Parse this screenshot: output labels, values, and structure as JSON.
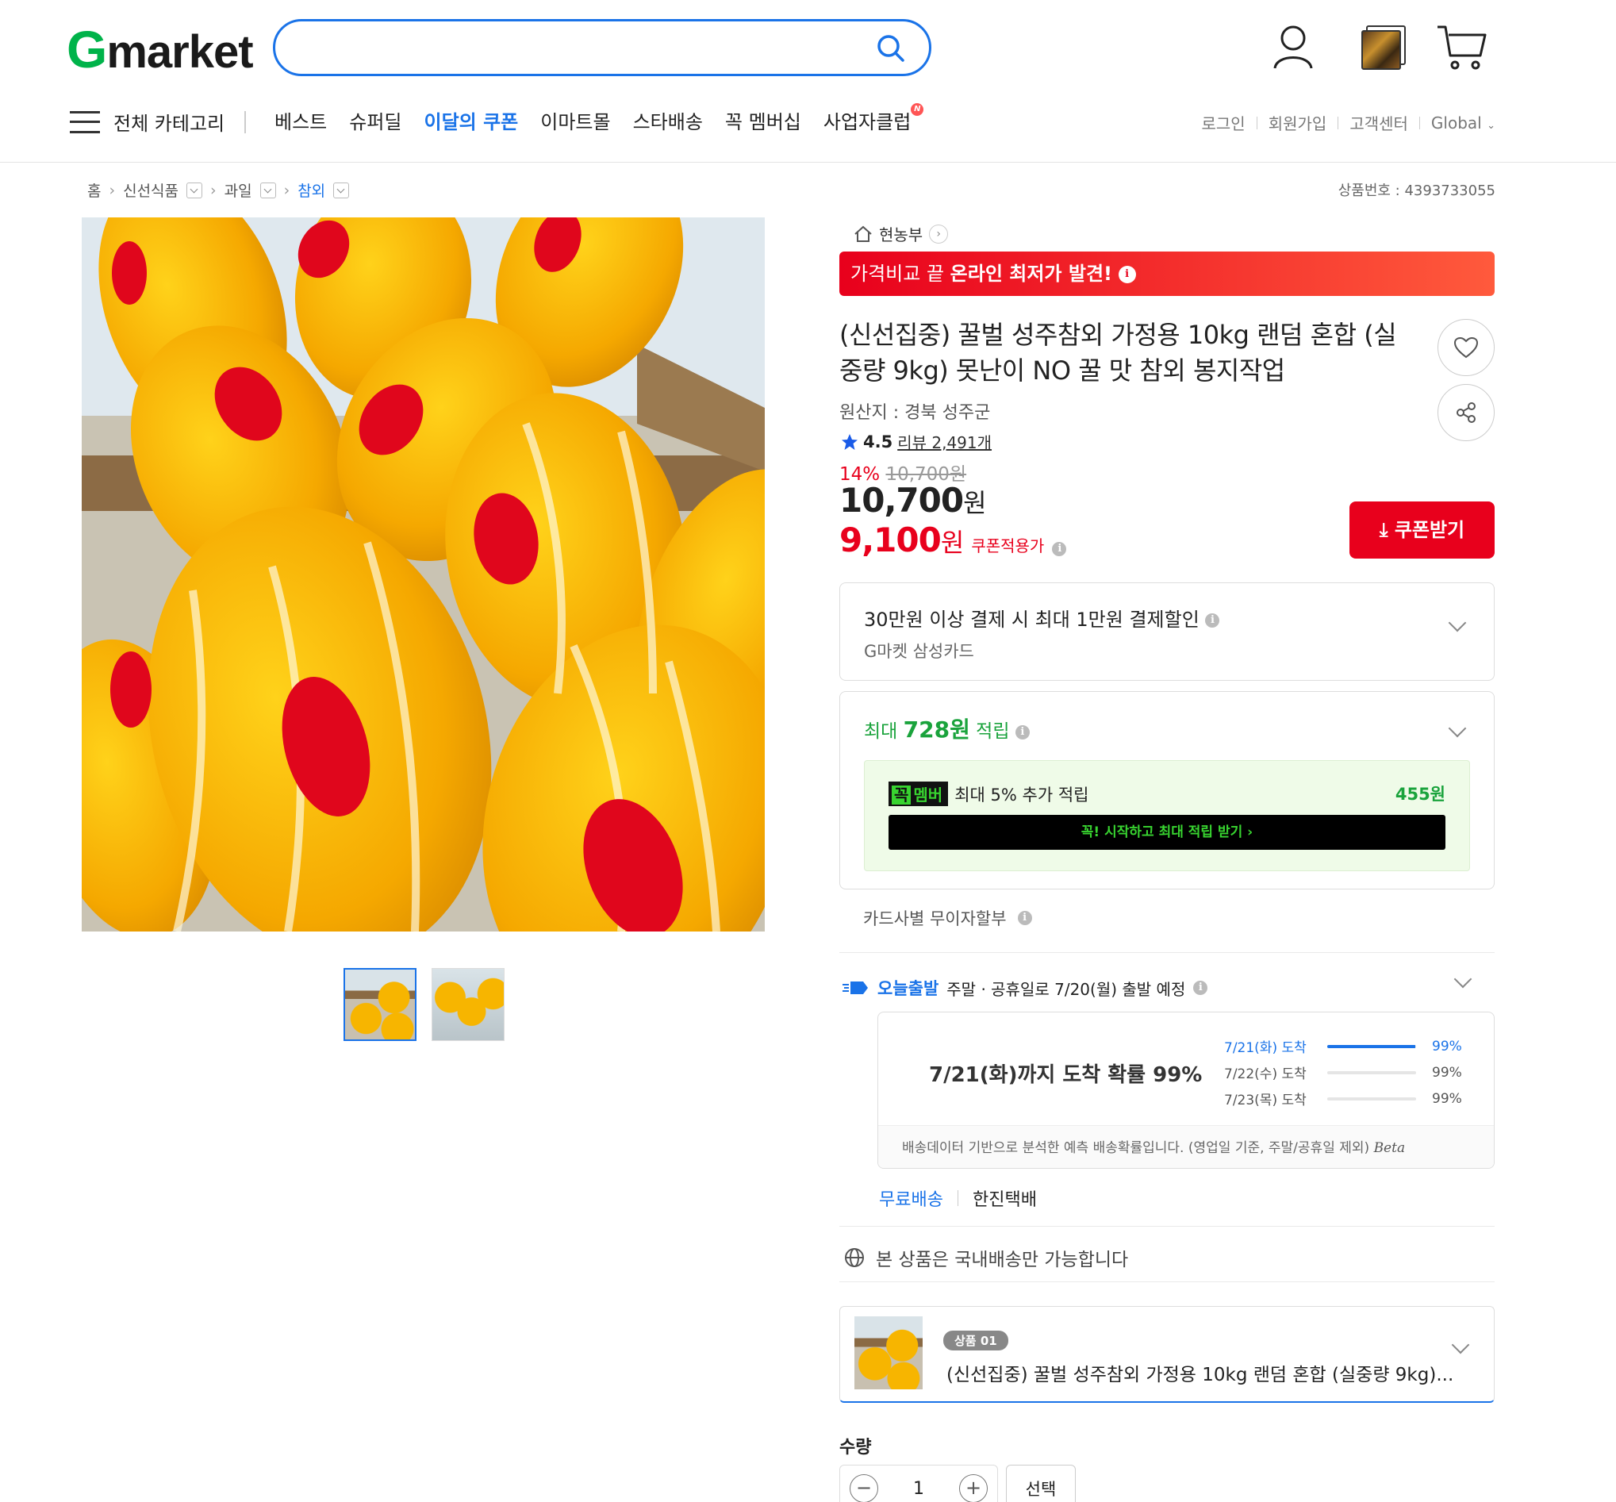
{
  "header": {
    "logo_g": "G",
    "logo_rest": "market",
    "search_placeholder": "",
    "icons": [
      "search-icon",
      "user-icon",
      "recent-item-icon",
      "cart-icon"
    ]
  },
  "nav": {
    "all_categories": "전체 카테고리",
    "links": [
      "베스트",
      "슈퍼딜",
      "이달의 쿠폰",
      "이마트몰",
      "스타배송",
      "꼭 멤버십",
      "사업자클럽"
    ],
    "new_badge": "N",
    "utils": [
      "로그인",
      "회원가입",
      "고객센터",
      "Global"
    ]
  },
  "breadcrumb": [
    "홈",
    "신선식품",
    "과일",
    "참외"
  ],
  "product_number": "상품번호 : 4393733055",
  "store": "현농부",
  "banner": {
    "prefix": "가격비교 끝 ",
    "bold": "온라인 최저가 발견!"
  },
  "product": {
    "title": "(신선집중) 꿀벌 성주참외 가정용 10kg 랜덤 혼합 (실중량 9kg) 못난이 NO 꿀 맛 참외 봉지작업",
    "origin": "원산지 : 경북 성주군",
    "rating": "4.5",
    "reviews": "리뷰 2,491개",
    "discount_pct": "14%",
    "original_price": "10,700원",
    "price_num": "10,700",
    "price_unit": "원",
    "coupon_price_num": "9,100",
    "coupon_price_unit": "원",
    "coupon_label": "쿠폰적용가",
    "coupon_button": "쿠폰받기"
  },
  "card_discount": {
    "title": "30만원 이상 결제 시 최대 1만원 결제할인",
    "sub": "G마켓 삼성카드"
  },
  "points": {
    "prefix": "최대 ",
    "amount": "728원",
    "suffix": " 적립",
    "member_tag_a": "꼭",
    "member_tag_b": "멤버",
    "member_text": "최대 5% 추가 적립",
    "member_points": "455원",
    "cta": "꼭! 시작하고 최대 적립 받기  ›"
  },
  "installment": "카드사별 무이자할부",
  "shipping": {
    "brand": "오늘출발",
    "text": "주말 · 공휴일로 7/20(월) 출발 예정",
    "headline": "7/21(화)까지 도착 확률 99%",
    "rows": [
      {
        "date": "7/21(화) 도착",
        "pct": "99%",
        "fill": 0.99
      },
      {
        "date": "7/22(수) 도착",
        "pct": "99%",
        "fill": 0.0
      },
      {
        "date": "7/23(목) 도착",
        "pct": "99%",
        "fill": 0.0
      }
    ],
    "note": "배송데이터 기반으로 분석한 예측 배송확률입니다. (영업일 기준, 주말/공휴일 제외) ",
    "beta": "Beta",
    "free": "무료배송",
    "courier": "한진택배"
  },
  "domestic": "본 상품은 국내배송만 가능합니다",
  "option": {
    "tag": "상품 01",
    "name": "(신선집중) 꿀벌 성주참외 가정용 10kg 랜덤 혼합 (실중량 9kg)..."
  },
  "quantity": {
    "label": "수량",
    "value": "1",
    "select": "선택"
  },
  "colors": {
    "accent": "#1a73e8",
    "red": "#e8001c",
    "green": "#1aa33c",
    "brand_green": "#00b34a"
  }
}
